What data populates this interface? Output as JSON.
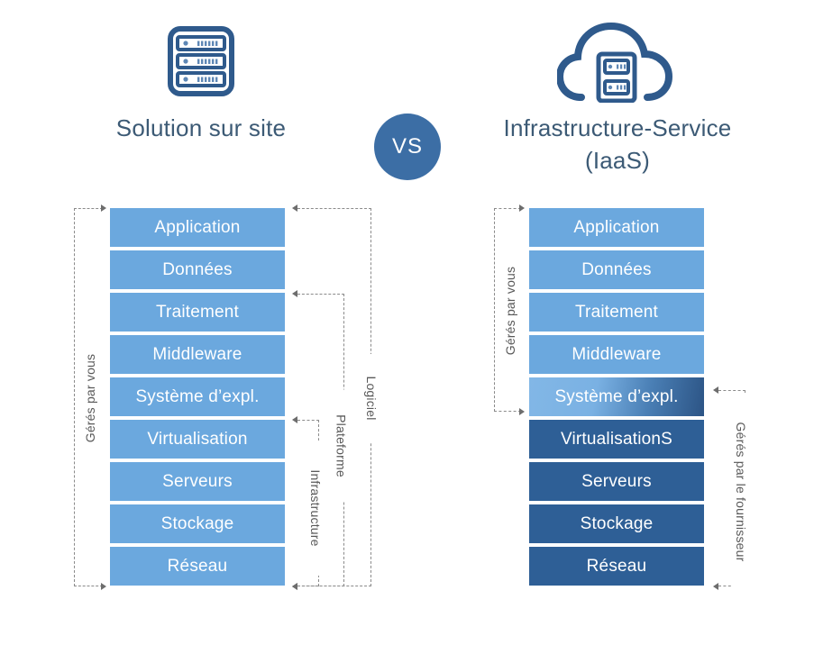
{
  "columns": {
    "left": {
      "icon": "server-rack-icon",
      "title": "Solution sur site",
      "layers": [
        {
          "label": "Application",
          "tone": "light"
        },
        {
          "label": "Données",
          "tone": "light"
        },
        {
          "label": "Traitement",
          "tone": "light"
        },
        {
          "label": "Middleware",
          "tone": "light"
        },
        {
          "label": "Système d’expl.",
          "tone": "light"
        },
        {
          "label": "Virtualisation",
          "tone": "light"
        },
        {
          "label": "Serveurs",
          "tone": "light"
        },
        {
          "label": "Stockage",
          "tone": "light"
        },
        {
          "label": "Réseau",
          "tone": "light"
        }
      ]
    },
    "right": {
      "icon": "cloud-server-icon",
      "title_line1": "Infrastructure-Service",
      "title_line2": "(IaaS)",
      "layers": [
        {
          "label": "Application",
          "tone": "light"
        },
        {
          "label": "Données",
          "tone": "light"
        },
        {
          "label": "Traitement",
          "tone": "light"
        },
        {
          "label": "Middleware",
          "tone": "light"
        },
        {
          "label": "Système d’expl.",
          "tone": "gradient"
        },
        {
          "label": "VirtualisationS",
          "tone": "dark"
        },
        {
          "label": "Serveurs",
          "tone": "dark"
        },
        {
          "label": "Stockage",
          "tone": "dark"
        },
        {
          "label": "Réseau",
          "tone": "dark"
        }
      ]
    }
  },
  "vs_badge": {
    "label": "VS"
  },
  "brackets": {
    "left_managed_by_you": "Gérés par vous",
    "right_managed_by_you": "Gérés par vous",
    "right_managed_by_provider": "Gérés par le fournisseur",
    "software": "Logiciel",
    "platform": "Plateforme",
    "infrastructure": "Infrastructure"
  },
  "colors": {
    "layer_light": "#6BA8DE",
    "layer_dark": "#2E5F96",
    "badge": "#3C6EA5",
    "title_text": "#3C5A75",
    "bracket_line": "#8A8A8A",
    "background": "#FFFFFF"
  }
}
